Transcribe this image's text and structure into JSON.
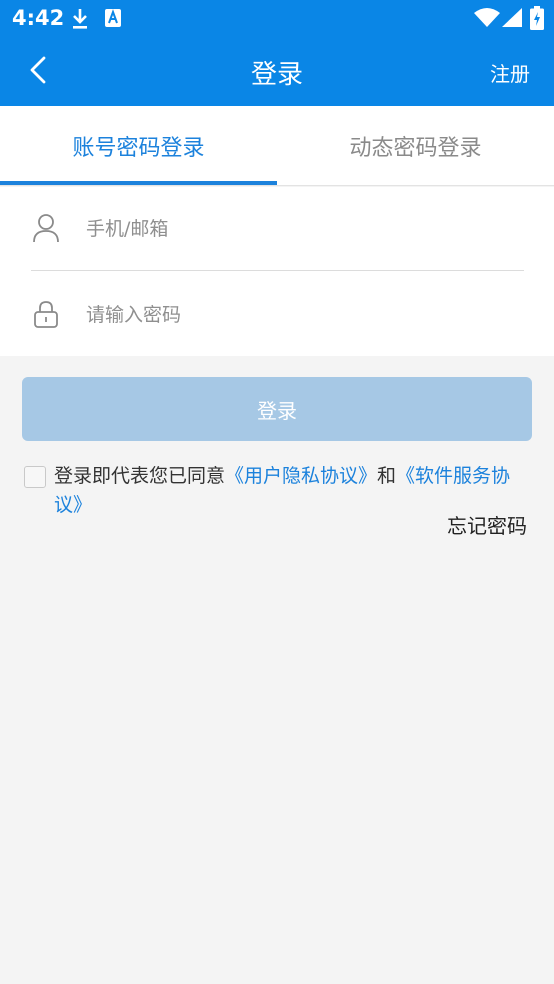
{
  "status_bar": {
    "time": "4:42",
    "icons": [
      "download-icon",
      "keyboard-a-icon",
      "wifi-icon",
      "signal-icon",
      "battery-icon"
    ]
  },
  "app_bar": {
    "title": "登录",
    "register_label": "注册",
    "back_icon": "chevron-left-icon"
  },
  "tabs": [
    {
      "label": "账号密码登录",
      "active": true
    },
    {
      "label": "动态密码登录",
      "active": false
    }
  ],
  "form": {
    "account_placeholder": "手机/邮箱",
    "account_icon": "user-icon",
    "password_placeholder": "请输入密码",
    "password_icon": "lock-icon"
  },
  "login_button": "登录",
  "agreement": {
    "prefix": "登录即代表您已同意",
    "privacy_link": "《用户隐私协议》",
    "conjunction": "和",
    "service_link": "《软件服务协议》"
  },
  "forgot_password": "忘记密码",
  "colors": {
    "primary": "#0a86e6",
    "accent": "#1c82dc",
    "disabled_button": "#a6c8e5",
    "background": "#f4f4f4"
  }
}
